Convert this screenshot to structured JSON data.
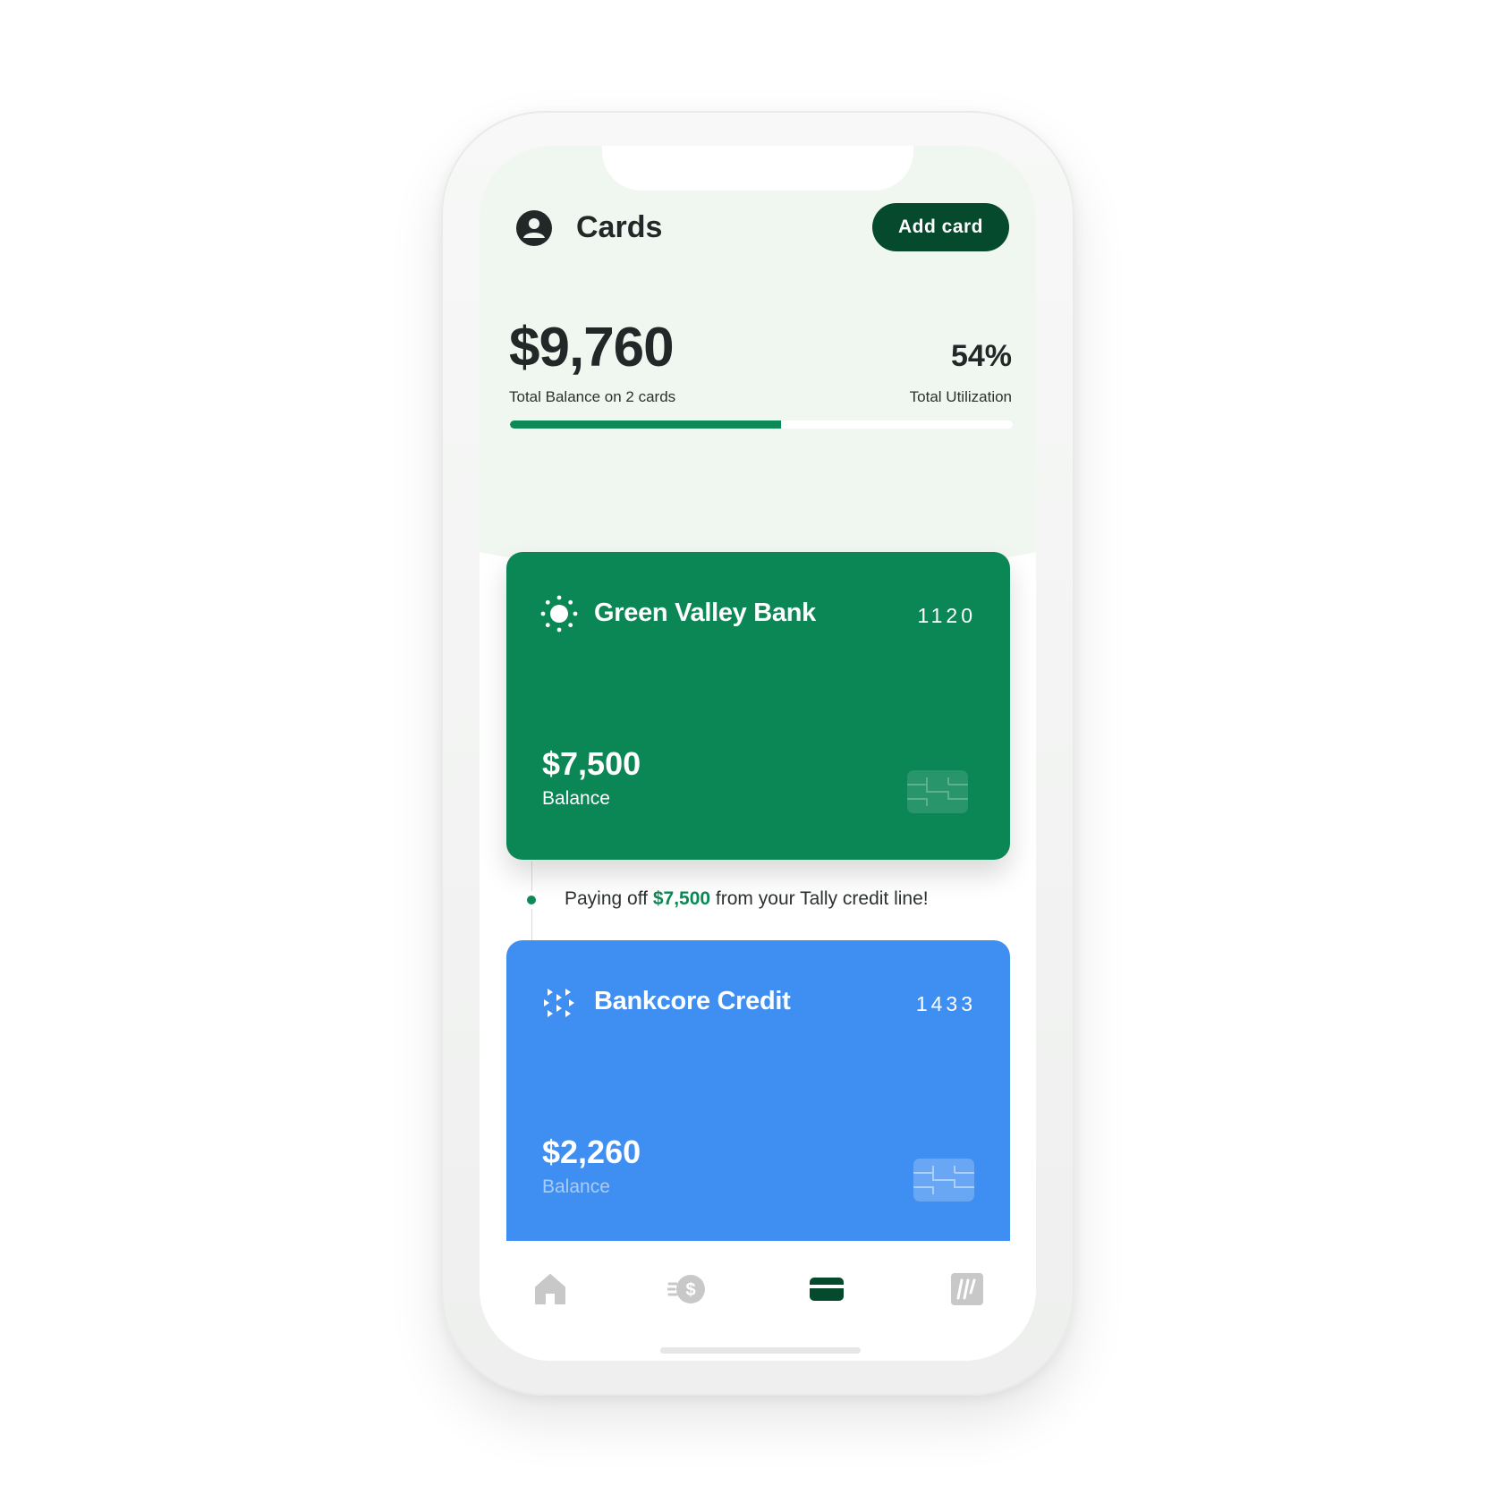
{
  "header": {
    "title": "Cards",
    "add_card_label": "Add card",
    "total_balance": "$9,760",
    "total_balance_label": "Total Balance on 2 cards",
    "utilization": "54%",
    "utilization_label": "Total Utilization",
    "utilization_fraction": 0.54
  },
  "cards": [
    {
      "bank": "Green Valley Bank",
      "last4": "1120",
      "balance": "$7,500",
      "balance_label": "Balance",
      "color": "#0b8756",
      "icon": "sun-icon"
    },
    {
      "bank": "Bankcore Credit",
      "last4": "1433",
      "balance": "$2,260",
      "balance_label": "Balance",
      "color": "#3f8ff2",
      "icon": "bankcore-logo-icon"
    }
  ],
  "timeline": {
    "prefix": "Paying off ",
    "amount": "$7,500",
    "suffix": " from your Tally credit line!"
  },
  "nav": {
    "items": [
      {
        "name": "home",
        "icon": "home-icon",
        "active": false
      },
      {
        "name": "pay",
        "icon": "dollar-transfer-icon",
        "active": false
      },
      {
        "name": "cards",
        "icon": "card-icon",
        "active": true
      },
      {
        "name": "tally",
        "icon": "tally-logo-icon",
        "active": false
      }
    ]
  },
  "colors": {
    "primary_dark": "#054a2c",
    "accent_green": "#0c8a56",
    "header_bg": "#eff7f0",
    "card_blue": "#3f8ff2",
    "inactive_icon": "#c8c8c8"
  }
}
